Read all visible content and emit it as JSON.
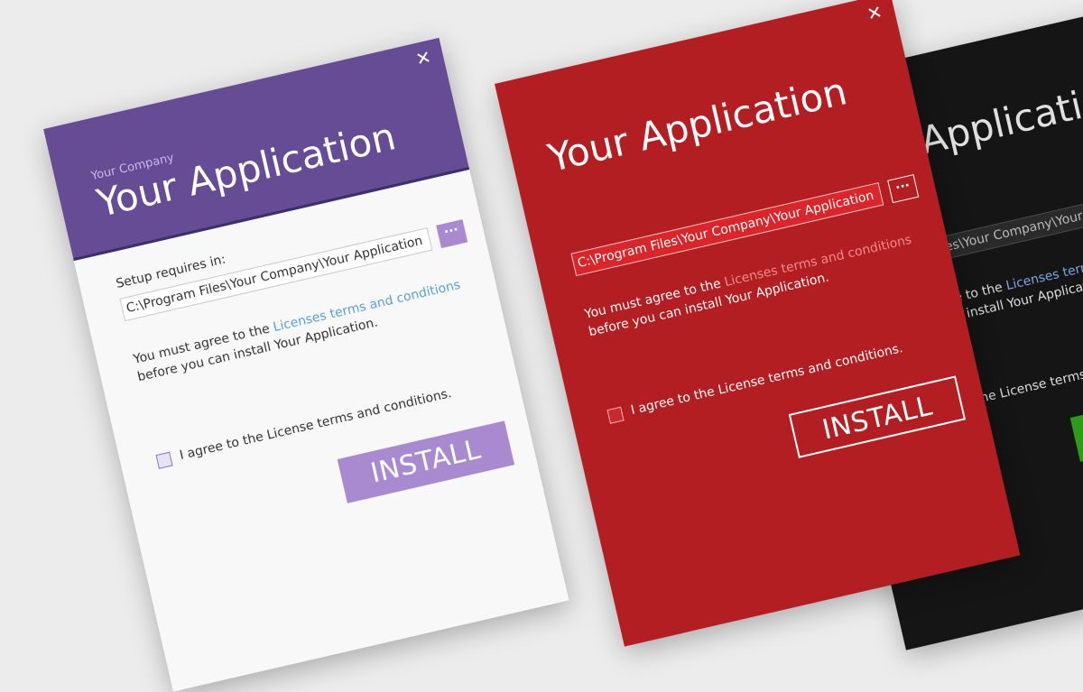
{
  "colors": {
    "background": "#ececed",
    "purple_header": "#654c95",
    "purple_accent": "#a98ad0",
    "red_theme": "#b21e22",
    "dark_theme": "#151515",
    "green_install": "#2d9a1a"
  },
  "icons": {
    "close": "close-icon",
    "browse": "ellipsis-icon"
  },
  "installer": {
    "close_label": "✕",
    "company": "Your Company",
    "app_title": "Your Application",
    "setup_label": "Setup requires in:",
    "install_path": "C:\\Program Files\\Your Company\\Your Application",
    "browse_label": "···",
    "agree_prefix": "You must agree to the ",
    "agree_link": "Licenses terms and conditions",
    "agree_suffix": " before you can install Your Application.",
    "checkbox_label": "I agree to the License terms and conditions.",
    "install_label": "INSTALL"
  },
  "themes": [
    "purple",
    "red",
    "dark"
  ]
}
